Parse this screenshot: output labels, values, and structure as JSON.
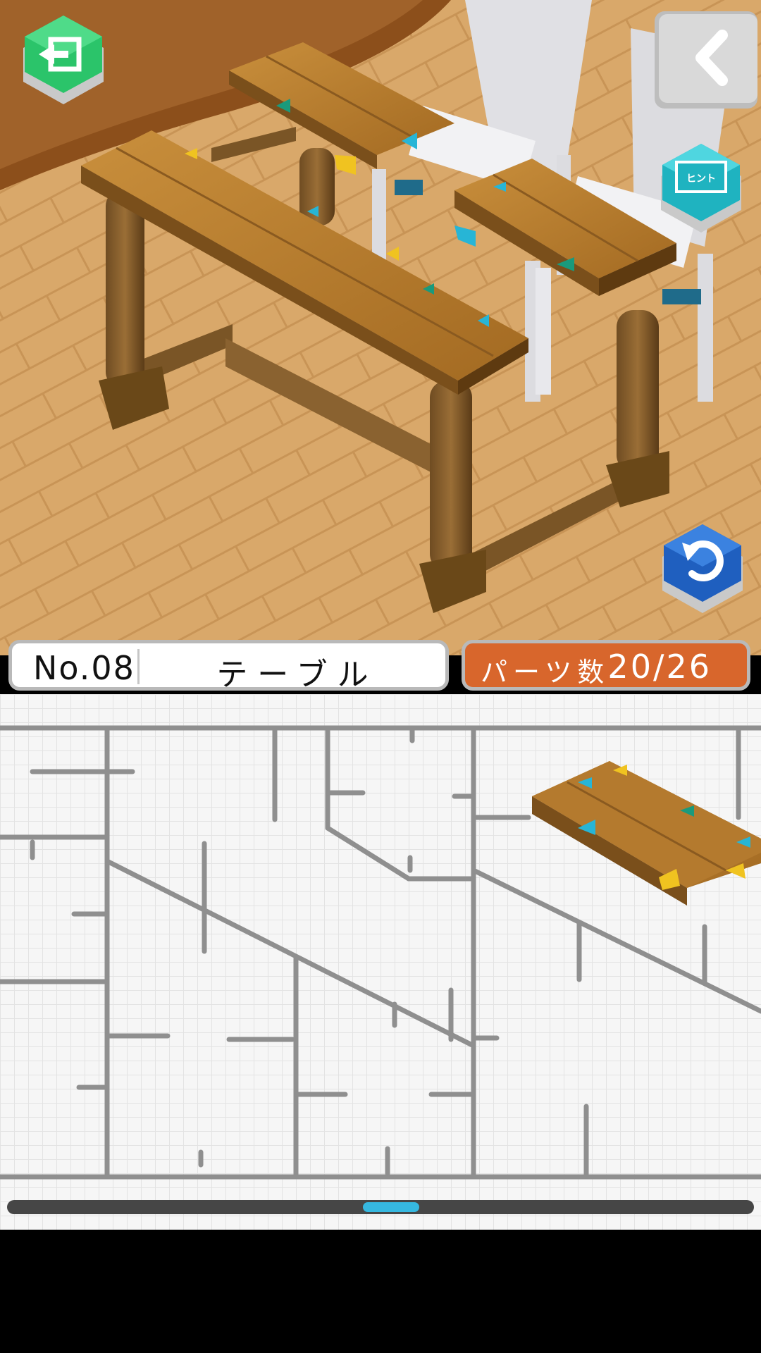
{
  "level": {
    "number": "No.08",
    "name": "テーブル"
  },
  "parts": {
    "label": "パーツ数",
    "count": "20/26"
  },
  "buttons": {
    "hint_label": "ヒント"
  },
  "colors": {
    "info_accent": "#d8662c",
    "exit_button": "#2bc46a",
    "hint_button": "#2fc7d4",
    "undo_button": "#1f5fbf",
    "scroll_thumb": "#36b8e0"
  },
  "icons": {
    "exit": "exit-door-icon",
    "back": "chevron-left-icon",
    "hint": "film-hint-icon",
    "undo": "undo-arrow-icon"
  }
}
